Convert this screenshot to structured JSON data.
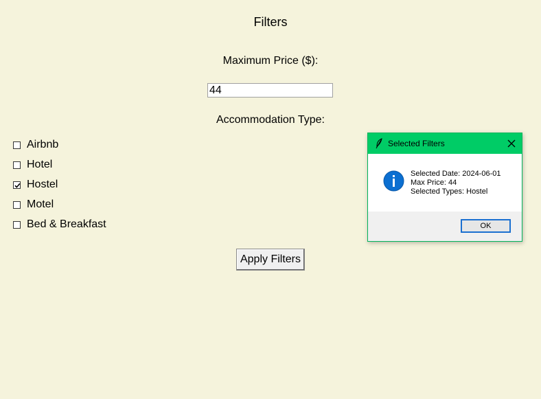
{
  "main": {
    "title": "Filters",
    "price_label": "Maximum Price ($):",
    "price_value": "44",
    "type_label": "Accommodation Type:",
    "types": [
      {
        "label": "Airbnb",
        "checked": false
      },
      {
        "label": "Hotel",
        "checked": false
      },
      {
        "label": "Hostel",
        "checked": true
      },
      {
        "label": "Motel",
        "checked": false
      },
      {
        "label": "Bed & Breakfast",
        "checked": false
      }
    ],
    "apply_label": "Apply Filters"
  },
  "dialog": {
    "title": "Selected Filters",
    "lines": [
      "Selected Date: 2024-06-01",
      "Max Price: 44",
      "Selected Types: Hostel"
    ],
    "ok_label": "OK",
    "titlebar_color": "#00cc66",
    "icon": "info-icon"
  },
  "colors": {
    "background": "#f5f3dc",
    "info_blue": "#0b6fd1",
    "focus_border": "#1a6fd0"
  }
}
